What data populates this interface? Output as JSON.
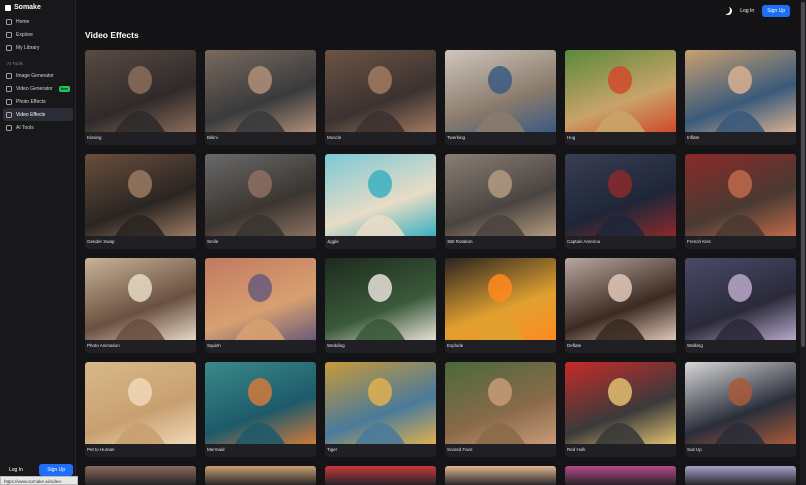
{
  "app": {
    "name": "Somake"
  },
  "sidebar": {
    "items": [
      {
        "label": "Home",
        "icon": "home-icon"
      },
      {
        "label": "Explore",
        "icon": "search-icon"
      },
      {
        "label": "My Library",
        "icon": "folder-icon"
      }
    ],
    "section_label": "AI Tools",
    "tools": [
      {
        "label": "Image Generator",
        "icon": "image-icon"
      },
      {
        "label": "Video Generator",
        "icon": "video-icon",
        "badge": "New"
      },
      {
        "label": "Photo Effects",
        "icon": "photo-icon"
      },
      {
        "label": "Video Effects",
        "icon": "film-icon",
        "active": true
      },
      {
        "label": "AI Tools",
        "icon": "sparkle-icon"
      }
    ],
    "login_label": "Log In",
    "signup_label": "Sign Up"
  },
  "header": {
    "login_label": "Log In",
    "signup_label": "Sign Up"
  },
  "page": {
    "title": "Video Effects"
  },
  "status_url": "https://www.somake.ai/video-effects",
  "effects": [
    {
      "label": "Kissing",
      "colors": [
        "#5a4a42",
        "#2f2a2a",
        "#8a6d5a"
      ]
    },
    {
      "label": "Bikini",
      "colors": [
        "#7a6a5e",
        "#3a3a3c",
        "#b08f78"
      ]
    },
    {
      "label": "Muscle",
      "colors": [
        "#6b5445",
        "#3c3230",
        "#a07a62"
      ]
    },
    {
      "label": "Twerking",
      "colors": [
        "#cfc6bc",
        "#8a7b6c",
        "#3b5a82"
      ]
    },
    {
      "label": "Hug",
      "colors": [
        "#5a8a3a",
        "#c9a36a",
        "#d04a2a"
      ]
    },
    {
      "label": "Inflate",
      "colors": [
        "#c9a070",
        "#3a5a7a",
        "#d8b090"
      ]
    },
    {
      "label": "Gender Swap",
      "colors": [
        "#6a4e3c",
        "#2a2522",
        "#9a7a62"
      ]
    },
    {
      "label": "Smile",
      "colors": [
        "#6a6a6a",
        "#3a3530",
        "#8c7060"
      ]
    },
    {
      "label": "Jiggle",
      "colors": [
        "#7ac9d6",
        "#e8dcc6",
        "#3ab0c0"
      ]
    },
    {
      "label": "360 Rotation",
      "colors": [
        "#8a7e74",
        "#4a4440",
        "#b49a80"
      ]
    },
    {
      "label": "Captain America",
      "colors": [
        "#3a3e52",
        "#1e2638",
        "#8a2a2a"
      ]
    },
    {
      "label": "French Kiss",
      "colors": [
        "#8a2a2a",
        "#4a3a32",
        "#c06a4a"
      ]
    },
    {
      "label": "Photo Animation",
      "colors": [
        "#c8b498",
        "#6a5040",
        "#e6d8c4"
      ]
    },
    {
      "label": "Squish",
      "colors": [
        "#c07a62",
        "#d8a070",
        "#6a5a7a"
      ]
    },
    {
      "label": "Wedding",
      "colors": [
        "#1e2a1e",
        "#3a5a3a",
        "#e8e0d8"
      ]
    },
    {
      "label": "Explode",
      "colors": [
        "#2a2420",
        "#e0a030",
        "#ff8a20"
      ]
    },
    {
      "label": "Deflate",
      "colors": [
        "#b8a8a0",
        "#3a2a22",
        "#e0c8b8"
      ]
    },
    {
      "label": "Walking",
      "colors": [
        "#4a4a6a",
        "#2a2a3a",
        "#b8a8c8"
      ]
    },
    {
      "label": "Pet to Human",
      "colors": [
        "#d8b888",
        "#c8a070",
        "#f0d8b8"
      ]
    },
    {
      "label": "Mermaid",
      "colors": [
        "#3a8a8a",
        "#1e5a6a",
        "#d07a3a"
      ]
    },
    {
      "label": "Tiger",
      "colors": [
        "#c89a3a",
        "#4a7a9a",
        "#e0b050"
      ]
    },
    {
      "label": "Scared Face",
      "colors": [
        "#4a6a3a",
        "#8a6a4a",
        "#c89a78"
      ]
    },
    {
      "label": "Red Hulk",
      "colors": [
        "#c82a2a",
        "#3a3a3a",
        "#e0c070"
      ]
    },
    {
      "label": "Suit Up",
      "colors": [
        "#d8d8d8",
        "#2a2e3a",
        "#a85a3a"
      ]
    }
  ],
  "partial_row_colors": [
    "#8a6a5a",
    "#c8a070",
    "#c83a3a",
    "#e0b890",
    "#b84a8a",
    "#a8a0c8"
  ]
}
